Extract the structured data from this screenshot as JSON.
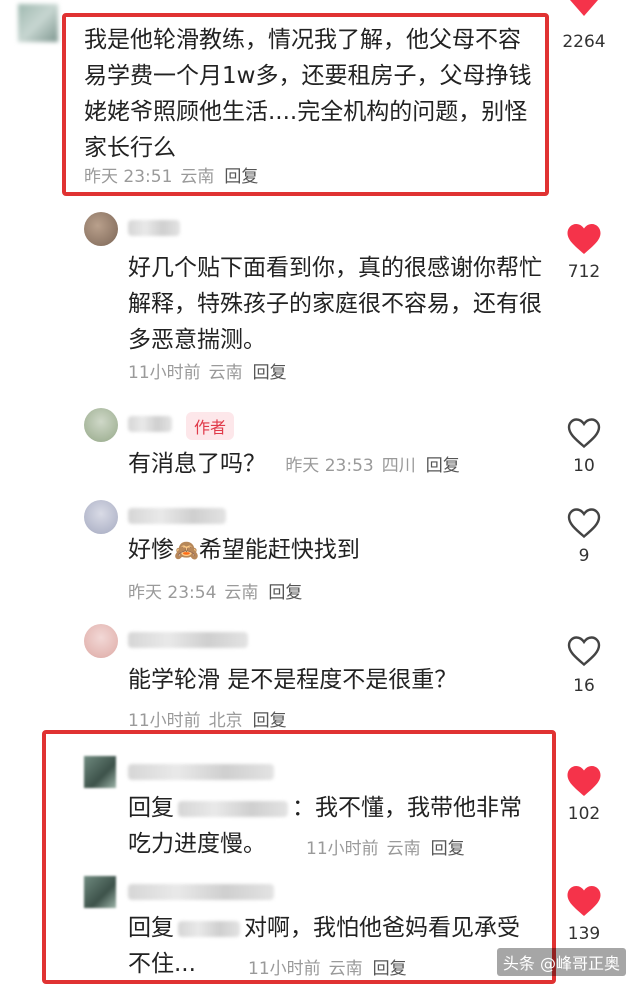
{
  "comments": [
    {
      "text": "我是他轮滑教练，情况我了解，他父母不容易学费一个月1w多，还要租房子，父母挣钱姥姥爷照顾他生活....完全机构的问题，别怪家长行么",
      "time": "昨天 23:51",
      "location": "云南",
      "reply": "回复",
      "likes": "2264"
    },
    {
      "text": "好几个贴下面看到你，真的很感谢你帮忙解释，特殊孩子的家庭很不容易，还有很多恶意揣测。",
      "time": "11小时前",
      "location": "云南",
      "reply": "回复",
      "likes": "712"
    },
    {
      "tag": "作者",
      "text": "有消息了吗？",
      "time": "昨天 23:53",
      "location": "四川",
      "reply": "回复",
      "likes": "10"
    },
    {
      "text_before": "好惨",
      "emoji": "🙈",
      "text_after": "希望能赶快找到",
      "time": "昨天 23:54",
      "location": "云南",
      "reply": "回复",
      "likes": "9"
    },
    {
      "text": "能学轮滑 是不是程度不是很重？",
      "time": "11小时前",
      "location": "北京",
      "reply": "回复",
      "likes": "16"
    },
    {
      "reply_prefix": "回复",
      "text": "：我不懂，我带他非常吃力进度慢。",
      "time": "11小时前",
      "location": "云南",
      "reply": "回复",
      "likes": "102"
    },
    {
      "reply_prefix": "回复",
      "text": "对啊，我怕他爸妈看见承受不住...",
      "time": "11小时前",
      "location": "云南",
      "reply": "回复",
      "likes": "139"
    }
  ],
  "partial_top_likes": "",
  "watermark": "头条 @峰哥正奥",
  "colors": {
    "heart_red": "#f5334a",
    "box_red": "#e03232",
    "meta_gray": "#9a9a9a"
  }
}
